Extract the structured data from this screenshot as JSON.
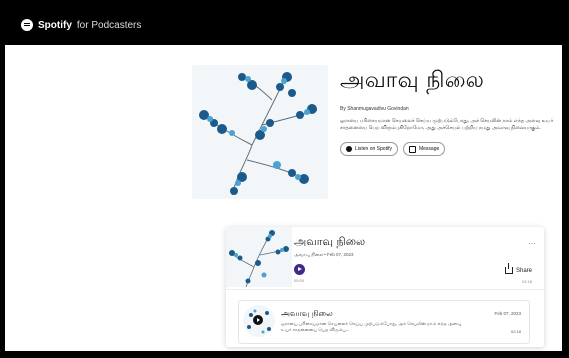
{
  "header": {
    "brand": "Spotify",
    "brand_sub": "for Podcasters",
    "icon": "spotify-logo-icon"
  },
  "show": {
    "title": "அவாவு நிலை",
    "author": "By Shanmugavadivu Govindan",
    "description": "ஓராயை பரிசையமான செயலைச் செய்ய முற்படும்போது, அச் செயலின் நாம் எந்த அளவு உயர் சாதனையை பெற விரும்புகிறோமோ, அது அச்செயல் பற்றிய நமது அவாவு நிலையாகும்.",
    "listen_label": "Listen on Spotify",
    "message_label": "Message",
    "listen_icon": "spotify-icon",
    "message_icon": "message-icon"
  },
  "player": {
    "episode_title": "அவாவு நிலை",
    "episode_meta": "அவாவு நிலை • Feb 07, 2023",
    "more": "⋯",
    "play_icon": "play-icon",
    "current_time": "00:00",
    "share_label": "Share",
    "share_icon": "share-icon",
    "duration": "02:18"
  },
  "episodes": [
    {
      "title": "அவாவு நிலை",
      "description": "ஓராயை பரிசையமான செயலைச் செய்ய முற்படும்போது, அச் செயலின் நாம் எந்த அளவு உயர் சாதனையை பெற விரும்பு...",
      "date": "Feb 07, 2023",
      "duration": "02:18"
    }
  ],
  "colors": {
    "topbar": "#000000",
    "play_button": "#3f2a8a",
    "blossom_dark": "#1c5a8c",
    "blossom_light": "#4aa3d1",
    "branch": "#5b6f7c"
  }
}
